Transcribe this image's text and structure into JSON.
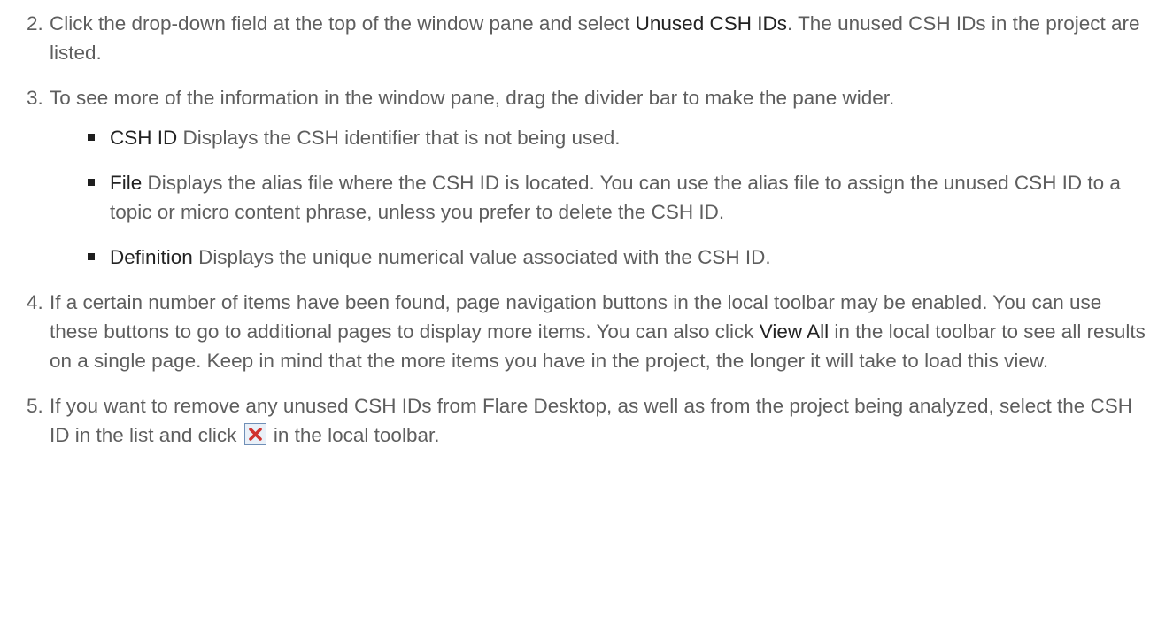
{
  "steps": [
    {
      "number": "2.",
      "text_a": "Click the drop-down field at the top of the window pane and select ",
      "term": "Unused CSH IDs",
      "text_b": ". The unused CSH IDs in the project are listed."
    },
    {
      "number": "3.",
      "text": "To see more of the information in the window pane, drag the divider bar to make the pane wider.",
      "bullets": [
        {
          "term": "CSH ID",
          "text": " Displays the CSH identifier that is not being used."
        },
        {
          "term": "File",
          "text": " Displays the alias file where the CSH ID is located. You can use the alias file to assign the unused CSH ID to a topic or micro content phrase, unless you prefer to delete the CSH ID."
        },
        {
          "term": "Definition",
          "text": " Displays the unique numerical value associated with the CSH ID."
        }
      ]
    },
    {
      "number": "4.",
      "text_a": "If a certain number of items have been found, page navigation buttons in the local toolbar may be enabled. You can use these buttons to go to additional pages to display more items. You can also click ",
      "term": "View All",
      "text_b": " in the local toolbar to see all results on a single page. Keep in mind that the more items you have in the project, the longer it will take to load this view."
    },
    {
      "number": "5.",
      "text_a": "If you want to remove any unused CSH IDs from Flare Desktop, as well as from the project being analyzed, select the CSH ID in the list and click ",
      "icon": "delete-x-icon",
      "text_b": " in the local toolbar."
    }
  ],
  "colors": {
    "body_text": "#5e5e5e",
    "term_text": "#222222",
    "delete_icon_red": "#d0312d",
    "delete_icon_border": "#6f8fb7"
  }
}
